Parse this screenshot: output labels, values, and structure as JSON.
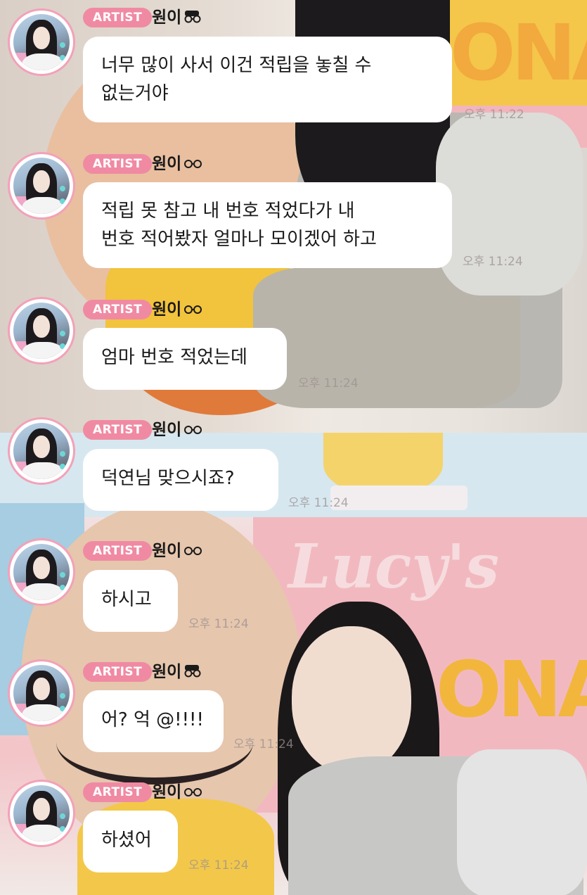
{
  "messages": [
    {
      "badge": "ARTIST",
      "name": "원이",
      "line1": "너무 많이 사서 이건 적립을 놓칠 수",
      "line2": "없는거야",
      "time": "오후 11:22"
    },
    {
      "badge": "ARTIST",
      "name": "원이",
      "line1": "적립 못 참고 내 번호 적었다가 내",
      "line2": "번호 적어봤자 얼마나 모이겠어 하고",
      "time": "오후 11:24"
    },
    {
      "badge": "ARTIST",
      "name": "원이",
      "line1": "엄마 번호 적었는데",
      "time": "오후 11:24"
    },
    {
      "badge": "ARTIST",
      "name": "원이",
      "line1": "덕연님 맞으시죠?",
      "time": "오후 11:24"
    },
    {
      "badge": "ARTIST",
      "name": "원이",
      "line1": "하시고",
      "time": "오후 11:24"
    },
    {
      "badge": "ARTIST",
      "name": "원이",
      "line1": "어? 억 @!!!!",
      "time": "오후 11:24"
    },
    {
      "badge": "ARTIST",
      "name": "원이",
      "line1": "하셨어",
      "time": "오후 11:24"
    }
  ],
  "background": {
    "sign_text_top": "ONA",
    "sign_text_bottom": "ONA",
    "lucys": "Lucy's"
  },
  "colors": {
    "badge": "#f08aa3",
    "avatar_ring": "#f3a1b8",
    "bubble": "#ffffff"
  },
  "icons": {
    "name_icon": "glasses-icon",
    "avatar": "profile-photo"
  }
}
